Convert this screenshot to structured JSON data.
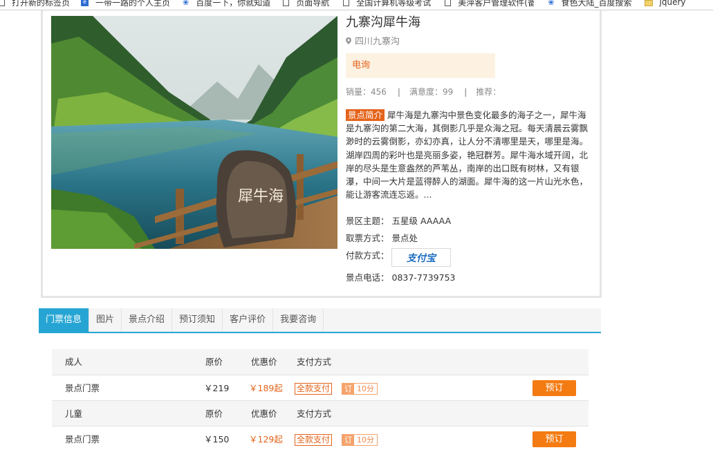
{
  "bookmarks": [
    {
      "label": "打开新的标签页",
      "icon": "page-icon"
    },
    {
      "label": "一带一路的个人主页",
      "icon": "blue-square-icon"
    },
    {
      "label": "百度一下，你就知道",
      "icon": "baidu-paw-icon"
    },
    {
      "label": "页面导航",
      "icon": "page-icon"
    },
    {
      "label": "全国计算机等级考试",
      "icon": "page-icon"
    },
    {
      "label": "美萍客户管理软件(备",
      "icon": "page-icon"
    },
    {
      "label": "食色大陆_百度搜索",
      "icon": "baidu-paw-icon"
    },
    {
      "label": "jquery",
      "icon": "folder-icon"
    }
  ],
  "product": {
    "title": "九寨沟犀牛海",
    "location": "四川九寨沟",
    "tag": "电询",
    "sales_label": "销量：456",
    "satisfaction_label": "满意度：99",
    "recommend_label": "推荐：",
    "separator": "|",
    "intro_badge": "景点简介",
    "intro_text": "犀牛海是九寨沟中景色变化最多的海子之一，犀牛海是九寨沟的第二大海，其倒影几乎是众海之冠。每天清晨云雾飘渺时的云雾倒影，亦幻亦真，让人分不清哪里是天，哪里是海。湖岸四周的彩叶也是亮丽多姿，艳冠群芳。犀牛海水域开阔，北岸的尽头是生意盎然的芦苇丛，南岸的出口既有树林，又有银瀑，中间一大片是蓝得醉人的湖面。犀牛海的这一片山光水色，能让游客流连忘返。...",
    "theme_label": "景区主题：",
    "theme_value": "五星级 AAAAA",
    "ticket_method_label": "取票方式：",
    "ticket_method_value": "景点处",
    "payment_label": "付款方式：",
    "payment_logo": "支付宝",
    "phone_label": "景点电话：",
    "phone_value": "0837-7739753",
    "stone_text": "犀牛海"
  },
  "tabs": [
    {
      "label": "门票信息",
      "active": true
    },
    {
      "label": "图片",
      "active": false
    },
    {
      "label": "景点介绍",
      "active": false
    },
    {
      "label": "预订须知",
      "active": false
    },
    {
      "label": "客户评价",
      "active": false
    },
    {
      "label": "我要咨询",
      "active": false
    }
  ],
  "tickets": {
    "groups": [
      {
        "category": "成人",
        "col_original": "原价",
        "col_discount": "优惠价",
        "col_payment": "支付方式",
        "ticket_name": "景点门票",
        "original_price": "￥219",
        "sale_price": "￥189起",
        "pay_badge": "全款支付",
        "order_badge": "订",
        "points": "10分",
        "book_label": "预订"
      },
      {
        "category": "儿童",
        "col_original": "原价",
        "col_discount": "优惠价",
        "col_payment": "支付方式",
        "ticket_name": "景点门票",
        "original_price": "￥150",
        "sale_price": "￥129起",
        "pay_badge": "全款支付",
        "order_badge": "订",
        "points": "10分",
        "book_label": "预订"
      }
    ]
  },
  "colors": {
    "accent_orange": "#e4631a",
    "book_button": "#f47b12",
    "tab_active": "#26a5d4"
  }
}
